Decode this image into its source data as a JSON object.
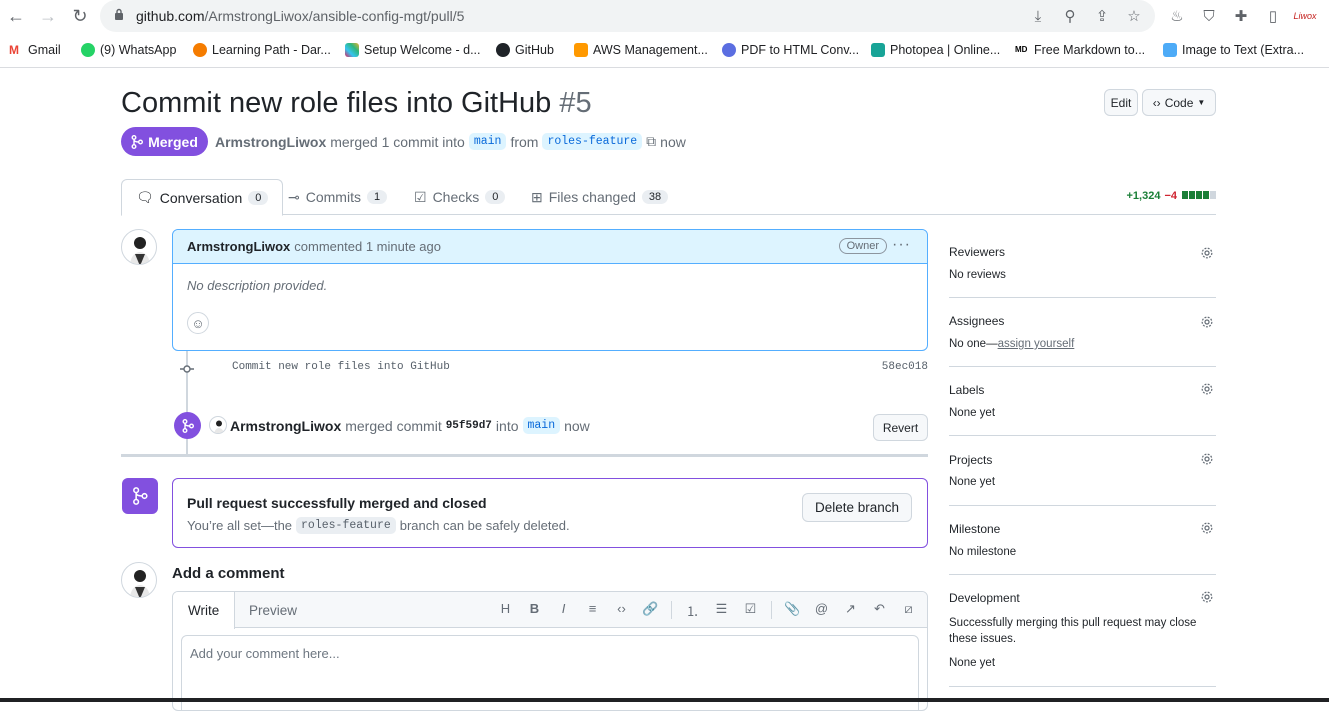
{
  "browser": {
    "url_domain": "github.com",
    "url_path": "/ArmstrongLiwox/ansible-config-mgt/pull/5",
    "bookmarks": [
      "Gmail",
      "(9) WhatsApp",
      "Learning Path - Dar...",
      "Setup Welcome - d...",
      "GitHub",
      "AWS Management...",
      "PDF to HTML Conv...",
      "Photopea | Online...",
      "Free Markdown to...",
      "Image to Text (Extra..."
    ],
    "profile_label": "Liwox"
  },
  "pr": {
    "title": "Commit new role files into GitHub",
    "number": "#5",
    "edit_label": "Edit",
    "code_label": "Code",
    "state_label": "Merged",
    "author": "ArmstrongLiwox",
    "merge_text": "merged 1 commit into",
    "base_branch": "main",
    "from_text": "from",
    "head_branch": "roles-feature",
    "time": "now"
  },
  "tabs": [
    {
      "label": "Conversation",
      "count": "0"
    },
    {
      "label": "Commits",
      "count": "1"
    },
    {
      "label": "Checks",
      "count": "0"
    },
    {
      "label": "Files changed",
      "count": "38"
    }
  ],
  "diffstat": {
    "additions": "+1,324",
    "deletions": "−4"
  },
  "comment": {
    "author": "ArmstrongLiwox",
    "action": "commented 1 minute ago",
    "badge": "Owner",
    "body": "No description provided."
  },
  "commit": {
    "message": "Commit new role files into GitHub",
    "sha": "58ec018"
  },
  "merge_event": {
    "author": "ArmstrongLiwox",
    "text": "merged commit",
    "sha": "95f59d7",
    "into": "into",
    "branch": "main",
    "time": "now",
    "revert_label": "Revert"
  },
  "merged_box": {
    "title": "Pull request successfully merged and closed",
    "sub_before": "You’re all set—the",
    "branch": "roles-feature",
    "sub_after": "branch can be safely deleted.",
    "delete_label": "Delete branch"
  },
  "add_comment": {
    "heading": "Add a comment",
    "write_tab": "Write",
    "preview_tab": "Preview",
    "placeholder": "Add your comment here..."
  },
  "sidebar": {
    "reviewers": {
      "label": "Reviewers",
      "value": "No reviews"
    },
    "assignees": {
      "label": "Assignees",
      "value": "No one—",
      "link": "assign yourself"
    },
    "labels": {
      "label": "Labels",
      "value": "None yet"
    },
    "projects": {
      "label": "Projects",
      "value": "None yet"
    },
    "milestone": {
      "label": "Milestone",
      "value": "No milestone"
    },
    "development": {
      "label": "Development",
      "desc": "Successfully merging this pull request may close these issues.",
      "value": "None yet"
    }
  },
  "colors": {
    "merged": "#8250df",
    "link": "#0969da",
    "add": "#1a7f37",
    "del": "#cf222e"
  }
}
